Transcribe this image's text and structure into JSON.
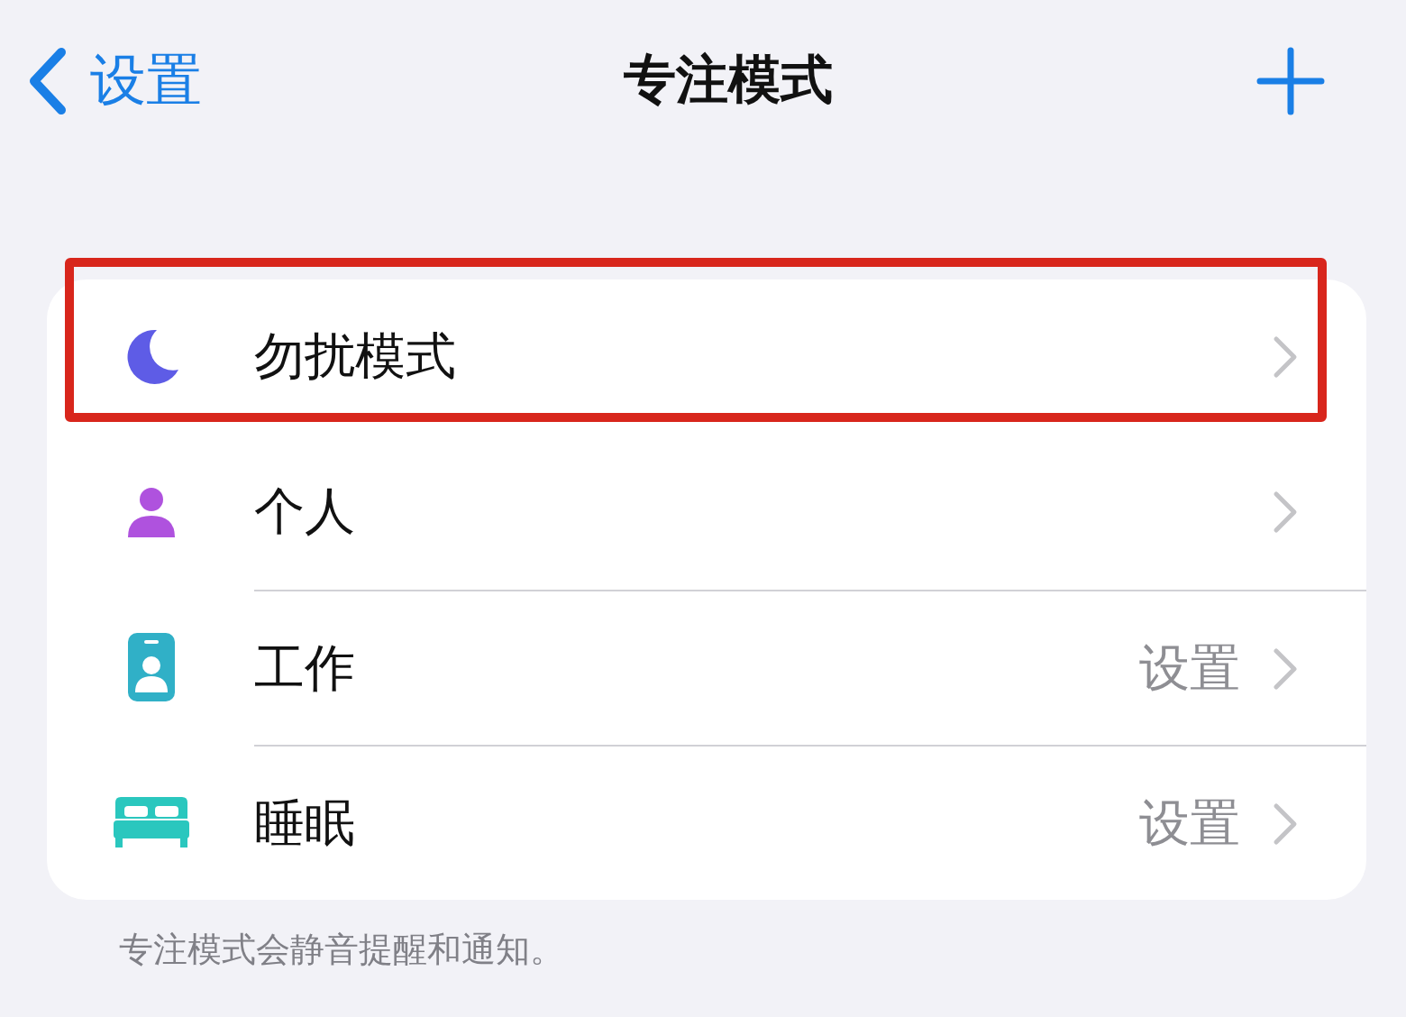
{
  "nav": {
    "back_label": "设置",
    "title": "专注模式"
  },
  "modes": [
    {
      "label": "勿扰模式",
      "kind": "moon",
      "color": "#5e5ce6",
      "highlighted": true
    },
    {
      "label": "个人",
      "kind": "person",
      "color": "#af52de",
      "highlighted": false
    },
    {
      "label": "工作",
      "kind": "badge",
      "color": "#30b0c7",
      "detail": "设置",
      "highlighted": false
    },
    {
      "label": "睡眠",
      "kind": "bed",
      "color": "#2ac7be",
      "detail": "设置",
      "highlighted": false
    }
  ],
  "footer": "专注模式会静音提醒和通知。"
}
